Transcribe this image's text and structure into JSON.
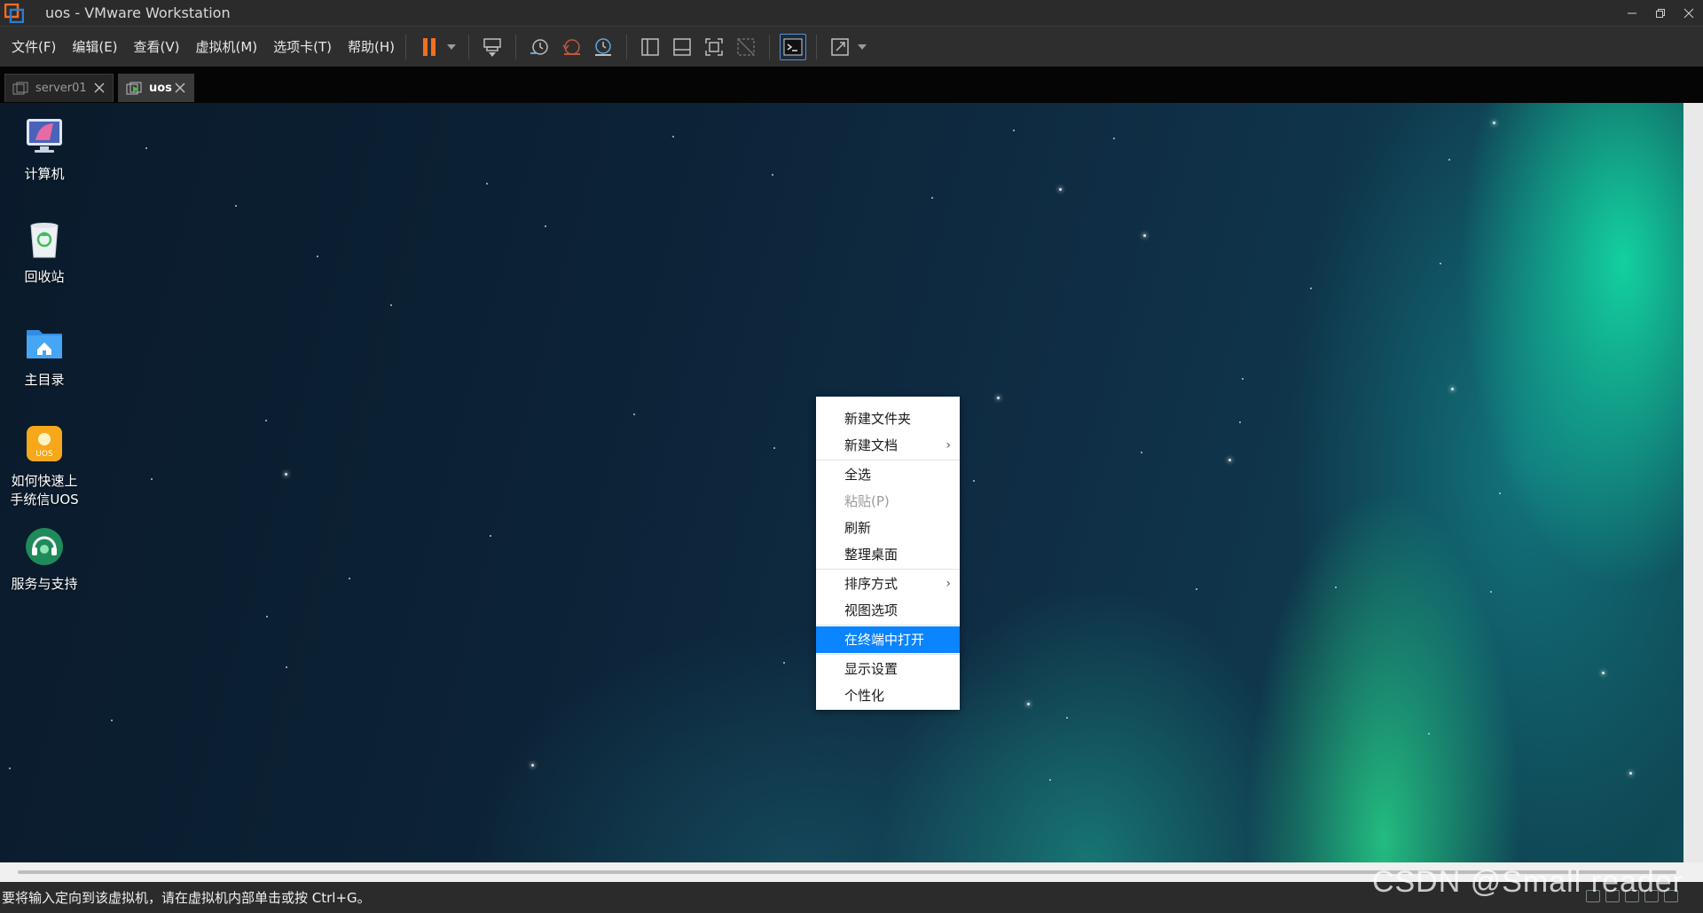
{
  "window": {
    "title": "uos - VMware Workstation",
    "accent": "#f26f21"
  },
  "menubar": {
    "items": [
      "文件(F)",
      "编辑(E)",
      "查看(V)",
      "虚拟机(M)",
      "选项卡(T)",
      "帮助(H)"
    ]
  },
  "toolbar": {
    "icons": [
      "pause-icon",
      "send-ctrl-alt-del-icon",
      "snapshot-take-icon",
      "snapshot-revert-icon",
      "snapshot-manager-icon",
      "library-view-icon",
      "thumbnail-view-icon",
      "fullscreen-icon",
      "unity-icon",
      "console-icon",
      "stretch-icon"
    ]
  },
  "tabs": [
    {
      "label": "server01",
      "active": false
    },
    {
      "label": "uos",
      "active": true
    }
  ],
  "desktop": {
    "icons": [
      {
        "label": "计算机",
        "icon": "computer-icon"
      },
      {
        "label": "回收站",
        "icon": "trash-icon"
      },
      {
        "label": "主目录",
        "icon": "home-folder-icon"
      },
      {
        "label": "如何快速上手统信UOS",
        "line1": "如何快速上",
        "line2": "手统信UOS",
        "icon": "uos-guide-icon"
      },
      {
        "label": "服务与支持",
        "icon": "support-icon"
      }
    ],
    "context_menu": {
      "items": [
        {
          "label": "新建文件夹"
        },
        {
          "label": "新建文档",
          "submenu": true
        },
        {
          "label": "全选"
        },
        {
          "label": "粘贴(P)",
          "disabled": true
        },
        {
          "label": "刷新"
        },
        {
          "label": "整理桌面"
        },
        {
          "label": "排序方式",
          "submenu": true
        },
        {
          "label": "视图选项"
        },
        {
          "label": "在终端中打开",
          "selected": true
        },
        {
          "label": "显示设置"
        },
        {
          "label": "个性化"
        }
      ],
      "selected_color": "#0a84ff"
    }
  },
  "statusbar": {
    "text": "要将输入定向到该虚拟机，请在虚拟机内部单击或按 Ctrl+G。"
  },
  "watermark": "CSDN @Small reader"
}
